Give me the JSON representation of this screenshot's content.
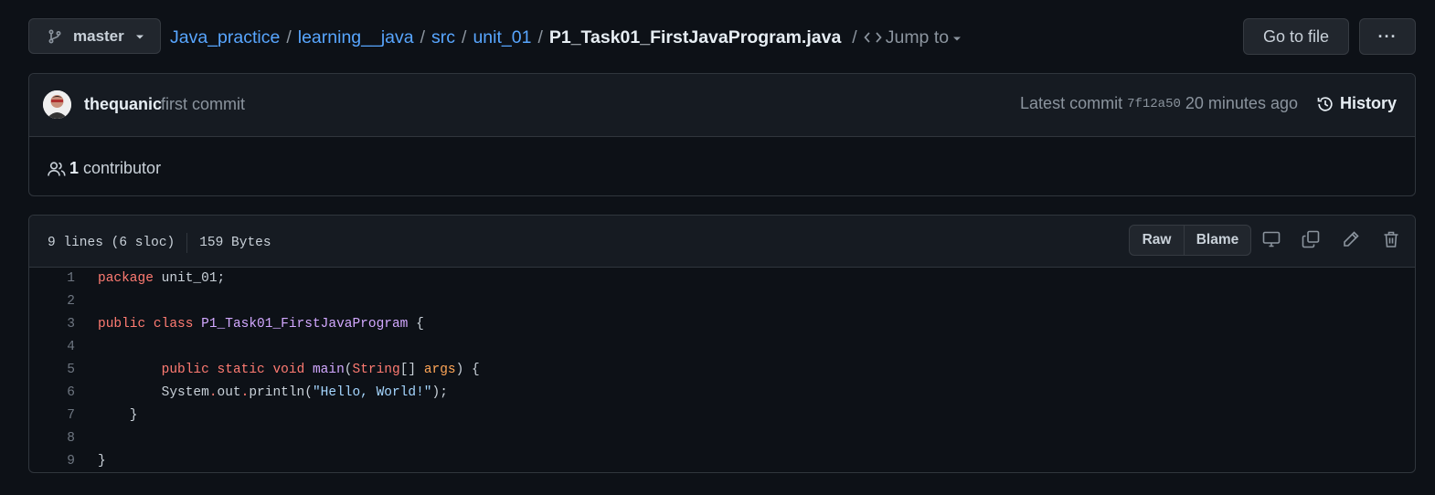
{
  "branch": {
    "name": "master"
  },
  "breadcrumb": {
    "repo": "Java_practice",
    "parts": [
      "learning__java",
      "src",
      "unit_01"
    ],
    "separator": "/",
    "file": "P1_Task01_FirstJavaProgram.java",
    "jump_label": "Jump to"
  },
  "actions": {
    "goto_file": "Go to file",
    "more": "···"
  },
  "commit": {
    "author": "thequanic",
    "message": "first commit",
    "latest_label": "Latest commit",
    "sha": "7f12a50",
    "time": "20 minutes ago",
    "history_label": "History"
  },
  "contributors": {
    "count": "1",
    "label": "contributor"
  },
  "file": {
    "lines_info": "9 lines (6 sloc)",
    "size": "159 Bytes",
    "raw_label": "Raw",
    "blame_label": "Blame",
    "code": [
      {
        "n": "1",
        "tokens": [
          {
            "t": "package",
            "c": "kw"
          },
          {
            "t": " unit_01;",
            "c": ""
          }
        ]
      },
      {
        "n": "2",
        "tokens": []
      },
      {
        "n": "3",
        "tokens": [
          {
            "t": "public",
            "c": "kw"
          },
          {
            "t": " ",
            "c": ""
          },
          {
            "t": "class",
            "c": "kw"
          },
          {
            "t": " ",
            "c": ""
          },
          {
            "t": "P1_Task01_FirstJavaProgram",
            "c": "ent"
          },
          {
            "t": " {",
            "c": ""
          }
        ]
      },
      {
        "n": "4",
        "tokens": []
      },
      {
        "n": "5",
        "tokens": [
          {
            "t": "        ",
            "c": ""
          },
          {
            "t": "public",
            "c": "kw"
          },
          {
            "t": " ",
            "c": ""
          },
          {
            "t": "static",
            "c": "kw"
          },
          {
            "t": " ",
            "c": ""
          },
          {
            "t": "void",
            "c": "kw"
          },
          {
            "t": " ",
            "c": ""
          },
          {
            "t": "main",
            "c": "ent"
          },
          {
            "t": "(",
            "c": ""
          },
          {
            "t": "String",
            "c": "kw"
          },
          {
            "t": "[] ",
            "c": ""
          },
          {
            "t": "args",
            "c": "var"
          },
          {
            "t": ") {",
            "c": ""
          }
        ]
      },
      {
        "n": "6",
        "tokens": [
          {
            "t": "        System",
            "c": ""
          },
          {
            "t": ".",
            "c": "kw"
          },
          {
            "t": "out",
            "c": ""
          },
          {
            "t": ".",
            "c": "kw"
          },
          {
            "t": "println(",
            "c": ""
          },
          {
            "t": "\"Hello, World!\"",
            "c": "str"
          },
          {
            "t": ");",
            "c": ""
          }
        ]
      },
      {
        "n": "7",
        "tokens": [
          {
            "t": "    }",
            "c": ""
          }
        ]
      },
      {
        "n": "8",
        "tokens": []
      },
      {
        "n": "9",
        "tokens": [
          {
            "t": "}",
            "c": ""
          }
        ]
      }
    ]
  },
  "icons": {
    "branch": "git-branch-icon",
    "code": "code-icon",
    "history": "history-icon",
    "people": "people-icon",
    "desktop": "desktop-icon",
    "copy": "copy-icon",
    "edit": "pencil-icon",
    "delete": "trash-icon"
  },
  "colors": {
    "background": "#0d1117",
    "panel": "#161b22",
    "border": "#30363d",
    "link": "#58a6ff",
    "keyword": "#ff7b72",
    "entity": "#d2a8ff",
    "variable": "#ffa657",
    "string": "#a5d6ff"
  }
}
